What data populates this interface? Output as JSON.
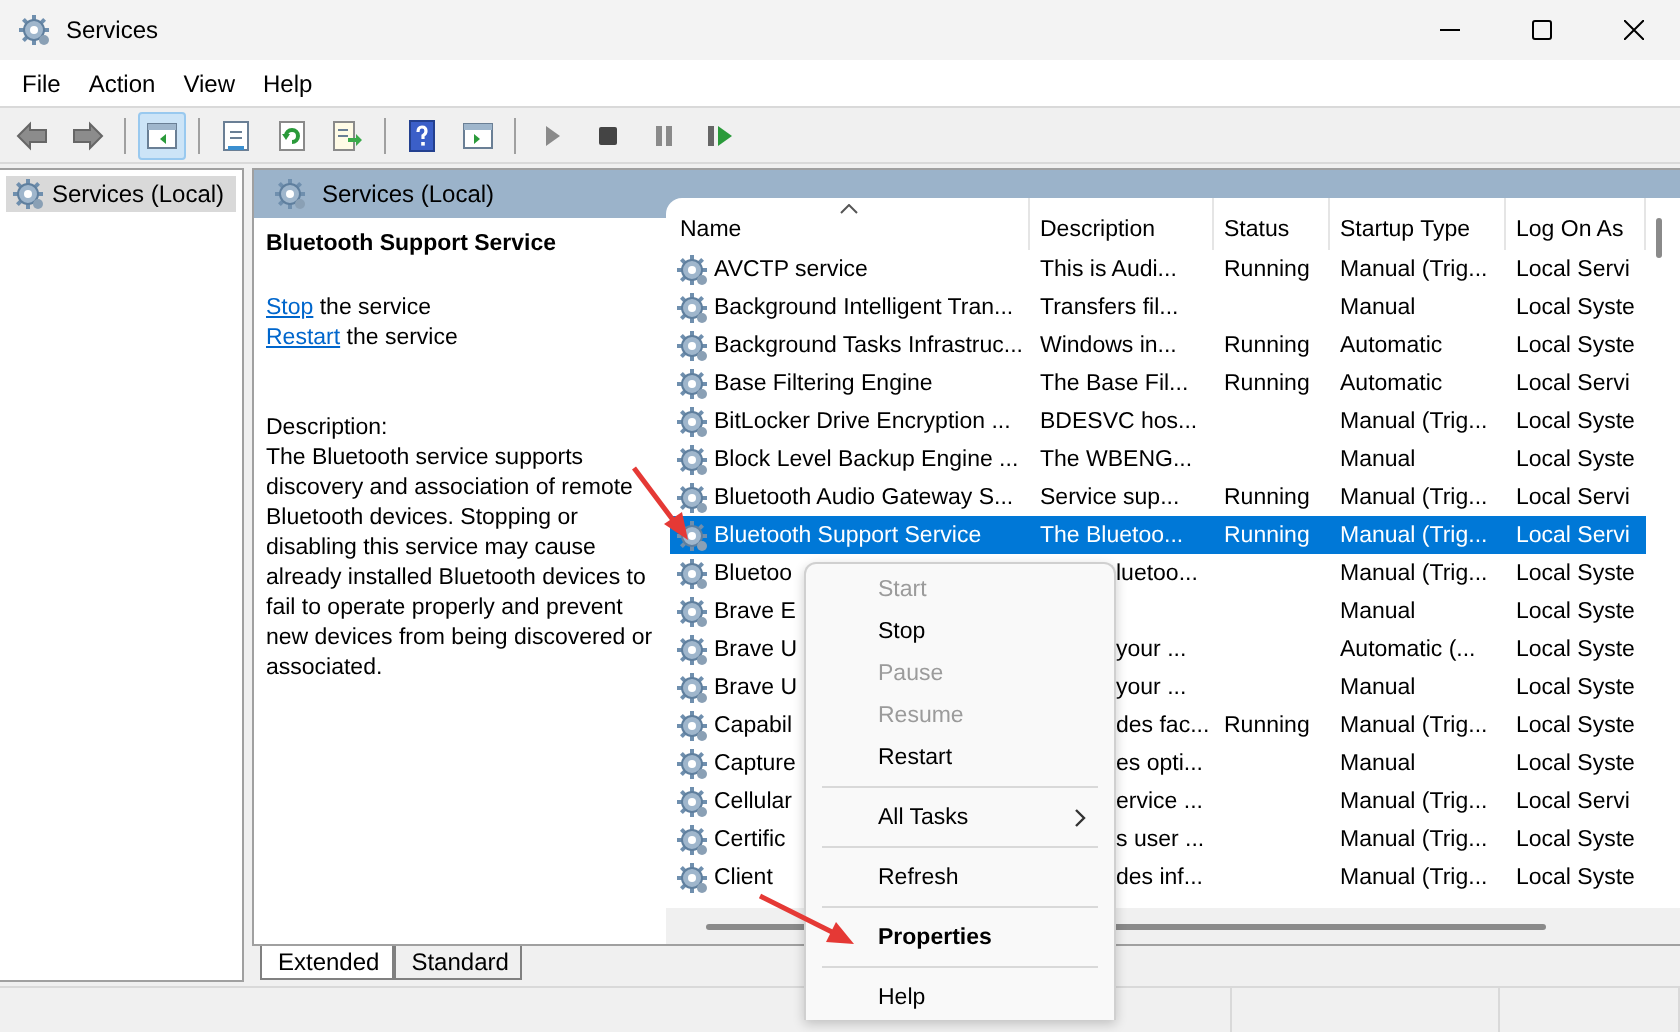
{
  "window": {
    "title": "Services"
  },
  "menu_bar": [
    "File",
    "Action",
    "View",
    "Help"
  ],
  "tree": [
    {
      "label": "Services (Local)",
      "selected": true
    }
  ],
  "panel_header": "Services (Local)",
  "details": {
    "title": "Bluetooth Support Service",
    "actions": [
      {
        "link": "Stop",
        "text": "the service"
      },
      {
        "link": "Restart",
        "text": "the service"
      }
    ],
    "description_label": "Description:",
    "description": "The Bluetooth service supports discovery and association of remote Bluetooth devices.  Stopping or disabling this service may cause already installed Bluetooth devices to fail to operate properly and prevent new devices from being discovered or associated."
  },
  "table": {
    "columns": [
      {
        "label": "Name",
        "sorted": true
      },
      {
        "label": "Description",
        "sorted": false
      },
      {
        "label": "Status",
        "sorted": false
      },
      {
        "label": "Startup Type",
        "sorted": false
      },
      {
        "label": "Log On As",
        "sorted": false
      }
    ],
    "rows": [
      {
        "cells": [
          "AVCTP service",
          "This is Audi...",
          "Running",
          "Manual (Trig...",
          "Local Servi"
        ],
        "selected": false,
        "covered": false
      },
      {
        "cells": [
          "Background Intelligent Tran...",
          "Transfers fil...",
          "",
          "Manual",
          "Local Syste"
        ],
        "selected": false,
        "covered": false
      },
      {
        "cells": [
          "Background Tasks Infrastruc...",
          "Windows in...",
          "Running",
          "Automatic",
          "Local Syste"
        ],
        "selected": false,
        "covered": false
      },
      {
        "cells": [
          "Base Filtering Engine",
          "The Base Fil...",
          "Running",
          "Automatic",
          "Local Servi"
        ],
        "selected": false,
        "covered": false
      },
      {
        "cells": [
          "BitLocker Drive Encryption ...",
          "BDESVC hos...",
          "",
          "Manual (Trig...",
          "Local Syste"
        ],
        "selected": false,
        "covered": false
      },
      {
        "cells": [
          "Block Level Backup Engine ...",
          "The WBENG...",
          "",
          "Manual",
          "Local Syste"
        ],
        "selected": false,
        "covered": false
      },
      {
        "cells": [
          "Bluetooth Audio Gateway S...",
          "Service sup...",
          "Running",
          "Manual (Trig...",
          "Local Servi"
        ],
        "selected": false,
        "covered": false
      },
      {
        "cells": [
          "Bluetooth Support Service",
          "The Bluetoo...",
          "Running",
          "Manual (Trig...",
          "Local Servi"
        ],
        "selected": true,
        "covered": false
      },
      {
        "cells": [
          "Bluetoo",
          "luetoo...",
          "",
          "Manual (Trig...",
          "Local Syste"
        ],
        "selected": false,
        "covered": true
      },
      {
        "cells": [
          "Brave E",
          "",
          "",
          "Manual",
          "Local Syste"
        ],
        "selected": false
      },
      {
        "cells": [
          "Brave U",
          "your ...",
          "",
          "Automatic (...",
          "Local Syste"
        ],
        "selected": false,
        "covered": true
      },
      {
        "cells": [
          "Brave U",
          "your ...",
          "",
          "Manual",
          "Local Syste"
        ],
        "selected": false,
        "covered": true
      },
      {
        "cells": [
          "Capabil",
          "des fac...",
          "Running",
          "Manual (Trig...",
          "Local Syste"
        ],
        "selected": false,
        "covered": true
      },
      {
        "cells": [
          "Capture",
          "es opti...",
          "",
          "Manual",
          "Local Syste"
        ],
        "selected": false,
        "covered": true
      },
      {
        "cells": [
          "Cellular",
          "ervice ...",
          "",
          "Manual (Trig...",
          "Local Servi"
        ],
        "selected": false,
        "covered": true
      },
      {
        "cells": [
          "Certific",
          "s user ...",
          "",
          "Manual (Trig...",
          "Local Syste"
        ],
        "selected": false,
        "covered": true
      },
      {
        "cells": [
          "Client",
          "des inf...",
          "",
          "Manual (Trig...",
          "Local Syste"
        ],
        "selected": false,
        "covered": true
      }
    ]
  },
  "tabs": [
    {
      "label": "Extended",
      "selected": true
    },
    {
      "label": "Standard",
      "selected": false
    }
  ],
  "context_menu": [
    {
      "kind": "item",
      "label": "Start",
      "disabled": true,
      "default": false,
      "submenu": false
    },
    {
      "kind": "item",
      "label": "Stop",
      "disabled": false,
      "default": false,
      "submenu": false
    },
    {
      "kind": "item",
      "label": "Pause",
      "disabled": true,
      "default": false,
      "submenu": false
    },
    {
      "kind": "item",
      "label": "Resume",
      "disabled": true,
      "default": false,
      "submenu": false
    },
    {
      "kind": "item",
      "label": "Restart",
      "disabled": false,
      "default": false,
      "submenu": false
    },
    {
      "kind": "separator"
    },
    {
      "kind": "item",
      "label": "All Tasks",
      "disabled": false,
      "default": false,
      "submenu": true
    },
    {
      "kind": "separator"
    },
    {
      "kind": "item",
      "label": "Refresh",
      "disabled": false,
      "default": false,
      "submenu": false
    },
    {
      "kind": "separator"
    },
    {
      "kind": "item",
      "label": "Properties",
      "disabled": false,
      "default": true,
      "submenu": false
    },
    {
      "kind": "separator"
    },
    {
      "kind": "item",
      "label": "Help",
      "disabled": false,
      "default": false,
      "submenu": false
    }
  ]
}
